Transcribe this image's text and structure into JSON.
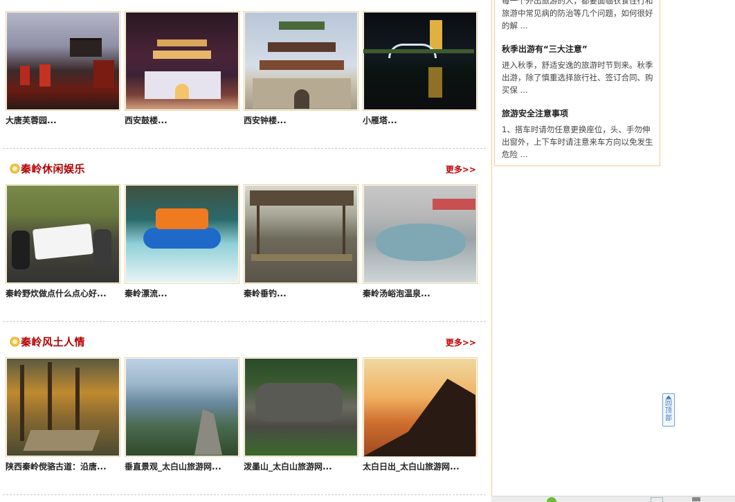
{
  "row_top": {
    "items": [
      {
        "caption": "大唐芙蓉园..."
      },
      {
        "caption": "西安鼓楼..."
      },
      {
        "caption": "西安钟楼..."
      },
      {
        "caption": "小雁塔..."
      }
    ]
  },
  "sections": [
    {
      "title": "秦岭休闲娱乐",
      "more": "更多>>",
      "items": [
        {
          "caption": "秦岭野炊做点什么点心好..."
        },
        {
          "caption": "秦岭漂流..."
        },
        {
          "caption": "秦岭垂钓..."
        },
        {
          "caption": "秦岭汤峪泡温泉..."
        }
      ]
    },
    {
      "title": "秦岭风土人情",
      "more": "更多>>",
      "items": [
        {
          "caption": "陕西秦岭傥骆古道：沿唐..."
        },
        {
          "caption": "垂直景观_太白山旅游网..."
        },
        {
          "caption": "泼墨山_太白山旅游网..."
        },
        {
          "caption": "太白日出_太白山旅游网..."
        }
      ]
    }
  ],
  "sidebar": {
    "intro_text": "每一个外出旅游的人，都要面临衣食住行和旅游中常见病的防治等几个问题，如何很好的解 ...",
    "articles": [
      {
        "title": "秋季出游有“三大注意”",
        "text": "进入秋季，舒适安逸的旅游时节到来。秋季出游，除了慎重选择旅行社、签订合同、购买保 ..."
      },
      {
        "title": "旅游安全注意事项",
        "text": "1、搭车时请勿任意更换座位，头、手勿伸出窗外，上下车时请注意来车方向以免发生危险 ..."
      }
    ]
  },
  "back_to_top": {
    "label": "回顶部"
  },
  "colors": {
    "section_title": "#b30000",
    "more_link": "#c00000",
    "frame": "#f2c98a"
  }
}
